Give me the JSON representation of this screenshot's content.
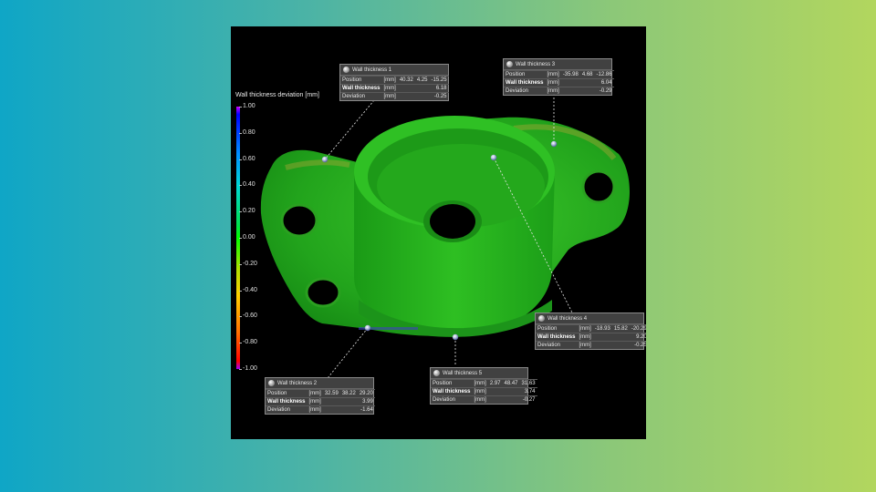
{
  "legend": {
    "title": "Wall thickness deviation [mm]",
    "ticks": [
      "1.00",
      "0.80",
      "0.60",
      "0.40",
      "0.20",
      "0.00",
      "-0.20",
      "-0.40",
      "-0.60",
      "-0.80",
      "-1.00"
    ]
  },
  "annotations": [
    {
      "title": "Wall thickness 1",
      "rows": [
        {
          "label": "Position",
          "unit": "[mm]",
          "values": [
            "40.32",
            "4.25",
            "-15.25"
          ]
        },
        {
          "label": "Wall thickness",
          "unit": "[mm]",
          "values": [
            "6.18"
          ],
          "bold": true
        },
        {
          "label": "Deviation",
          "unit": "[mm]",
          "values": [
            "-0.25"
          ]
        }
      ]
    },
    {
      "title": "Wall thickness 2",
      "rows": [
        {
          "label": "Position",
          "unit": "[mm]",
          "values": [
            "32.59",
            "38.22",
            "29.20"
          ]
        },
        {
          "label": "Wall thickness",
          "unit": "[mm]",
          "values": [
            "3.99"
          ],
          "bold": true
        },
        {
          "label": "Deviation",
          "unit": "[mm]",
          "values": [
            "-1.64"
          ]
        }
      ]
    },
    {
      "title": "Wall thickness 3",
      "rows": [
        {
          "label": "Position",
          "unit": "[mm]",
          "values": [
            "-35.98",
            "4.68",
            "-12.86"
          ]
        },
        {
          "label": "Wall thickness",
          "unit": "[mm]",
          "values": [
            "6.04"
          ],
          "bold": true
        },
        {
          "label": "Deviation",
          "unit": "[mm]",
          "values": [
            "-0.29"
          ]
        }
      ]
    },
    {
      "title": "Wall thickness 4",
      "rows": [
        {
          "label": "Position",
          "unit": "[mm]",
          "values": [
            "-18.93",
            "15.82",
            "-20.29"
          ]
        },
        {
          "label": "Wall thickness",
          "unit": "[mm]",
          "values": [
            "9.20"
          ],
          "bold": true
        },
        {
          "label": "Deviation",
          "unit": "[mm]",
          "values": [
            "-0.25"
          ]
        }
      ]
    },
    {
      "title": "Wall thickness 5",
      "rows": [
        {
          "label": "Position",
          "unit": "[mm]",
          "values": [
            "2.97",
            "48.47",
            "31.63"
          ]
        },
        {
          "label": "Wall thickness",
          "unit": "[mm]",
          "values": [
            "3.74"
          ],
          "bold": true
        },
        {
          "label": "Deviation",
          "unit": "[mm]",
          "values": [
            "-0.27"
          ]
        }
      ]
    }
  ]
}
